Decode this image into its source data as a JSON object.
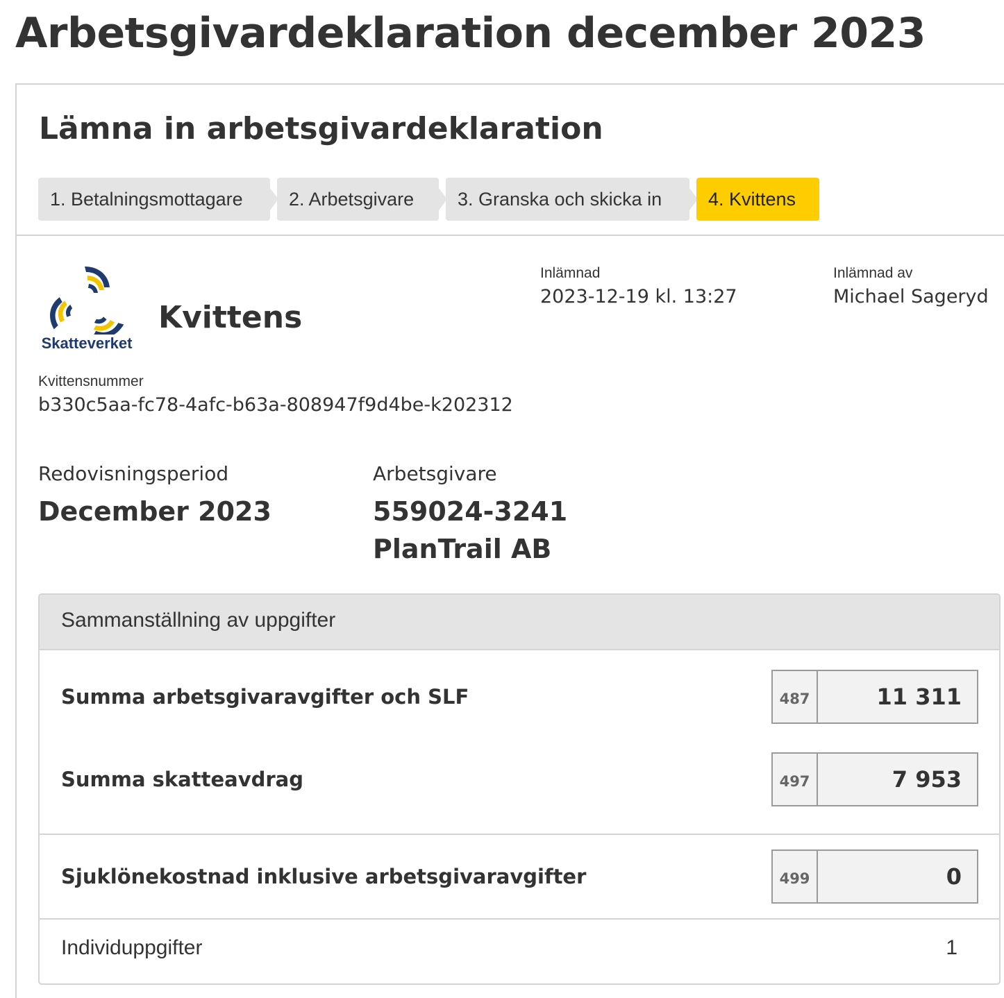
{
  "page_title": "Arbetsgivardeklaration december 2023",
  "card_title": "Lämna in arbetsgivardeklaration",
  "steps": [
    {
      "label": "1. Betalningsmottagare",
      "active": false
    },
    {
      "label": "2. Arbetsgivare",
      "active": false
    },
    {
      "label": "3. Granska och skicka in",
      "active": false
    },
    {
      "label": "4. Kvittens",
      "active": true
    }
  ],
  "colors": {
    "active_step": "#fecd00",
    "inactive_step": "#e4e4e4",
    "logo_blue": "#1f3a6e",
    "logo_yellow": "#f5c400"
  },
  "logo": {
    "text": "Skatteverket",
    "icon": "skatteverket-logo"
  },
  "receipt": {
    "heading": "Kvittens",
    "submitted_label": "Inlämnad",
    "submitted_value": "2023-12-19 kl. 13:27",
    "submitted_by_label": "Inlämnad av",
    "submitted_by_value": "Michael Sageryd",
    "number_label": "Kvittensnummer",
    "number_value": "b330c5aa-fc78-4afc-b63a-808947f9d4be-k202312"
  },
  "period": {
    "label": "Redovisningsperiod",
    "value": "December 2023"
  },
  "employer": {
    "label": "Arbetsgivare",
    "org_number": "559024-3241",
    "name": "PlanTrail AB"
  },
  "summary": {
    "heading": "Sammanställning av uppgifter",
    "rows": [
      {
        "label": "Summa arbetsgivaravgifter och SLF",
        "code": "487",
        "value": "11 311"
      },
      {
        "label": "Summa skatteavdrag",
        "code": "497",
        "value": "7 953"
      },
      {
        "label": "Sjuklönekostnad inklusive arbetsgivaravgifter",
        "code": "499",
        "value": "0"
      }
    ],
    "individ_label": "Individuppgifter",
    "individ_value": "1"
  }
}
